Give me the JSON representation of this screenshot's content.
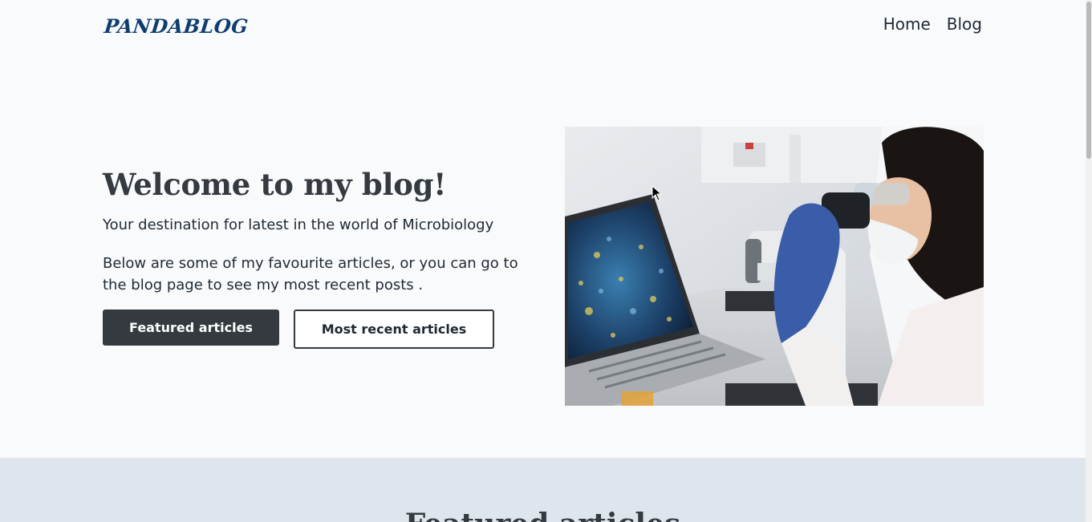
{
  "header": {
    "logo": "PANDABLOG",
    "nav": [
      {
        "label": "Home"
      },
      {
        "label": "Blog"
      }
    ]
  },
  "hero": {
    "title": "Welcome to my blog!",
    "subtitle": "Your destination for latest in the world of Microbiology",
    "description": "Below are some of my favourite articles, or you can go to the blog page to see my most recent posts .",
    "primary_button": "Featured articles",
    "secondary_button": "Most recent articles"
  },
  "featured": {
    "title": "Featured articles"
  },
  "colors": {
    "background": "#f8fafc",
    "logo": "#0f3d6e",
    "dark_button": "#343a40",
    "section_band": "#dfe5ec"
  }
}
